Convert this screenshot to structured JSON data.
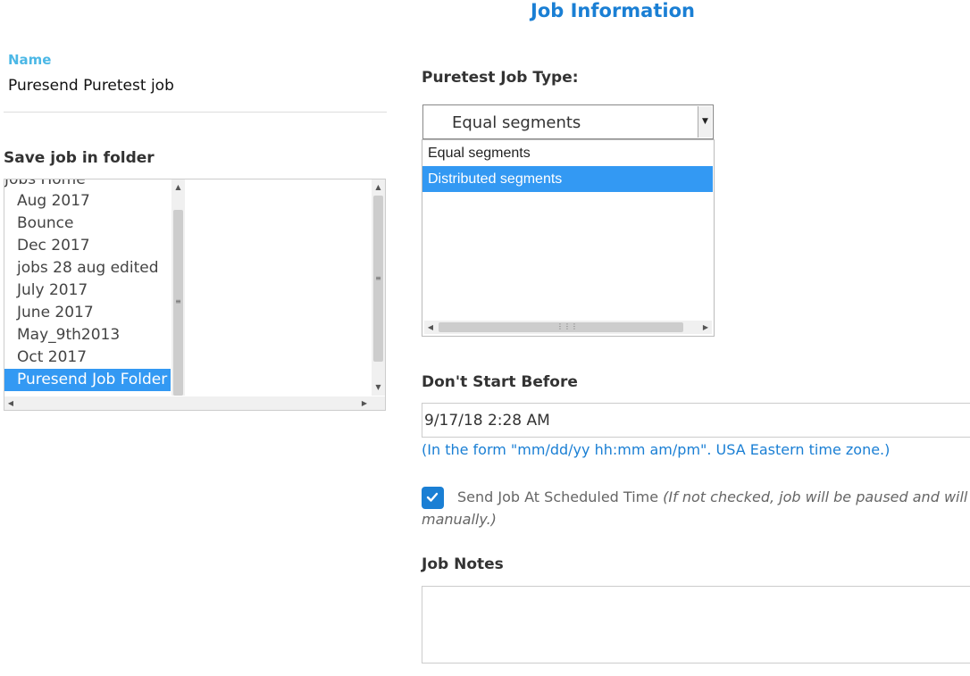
{
  "page_title": "Job Information",
  "name_field": {
    "label": "Name",
    "value": "Puresend Puretest job"
  },
  "folder": {
    "label": "Save job in folder",
    "items": [
      {
        "label": "Jobs Home"
      },
      {
        "label": "Aug 2017"
      },
      {
        "label": "Bounce"
      },
      {
        "label": "Dec 2017"
      },
      {
        "label": "jobs 28 aug edited"
      },
      {
        "label": "July 2017"
      },
      {
        "label": "June 2017"
      },
      {
        "label": "May_9th2013"
      },
      {
        "label": "Oct 2017"
      },
      {
        "label": "Puresend Job Folder"
      }
    ],
    "selected": "Puresend Job Folder"
  },
  "job_type": {
    "label": "Puretest Job Type:",
    "selected": "Equal segments",
    "options": [
      "Equal segments",
      "Distributed segments"
    ],
    "highlighted": "Distributed segments"
  },
  "dont_start": {
    "label": "Don't Start Before",
    "value": "9/17/18 2:28 AM",
    "help": "(In the form \"mm/dd/yy hh:mm am/pm\". USA Eastern time zone.)"
  },
  "send_scheduled": {
    "checked": true,
    "label": "Send Job At Scheduled Time",
    "note_line1": "(If not checked, job will be paused and will se",
    "note_line2": "manually.)"
  },
  "job_notes": {
    "label": "Job Notes",
    "value": ""
  },
  "colors": {
    "accent": "#1a7fd4",
    "name_label": "#4cb8e6",
    "selection": "#3399f3"
  }
}
